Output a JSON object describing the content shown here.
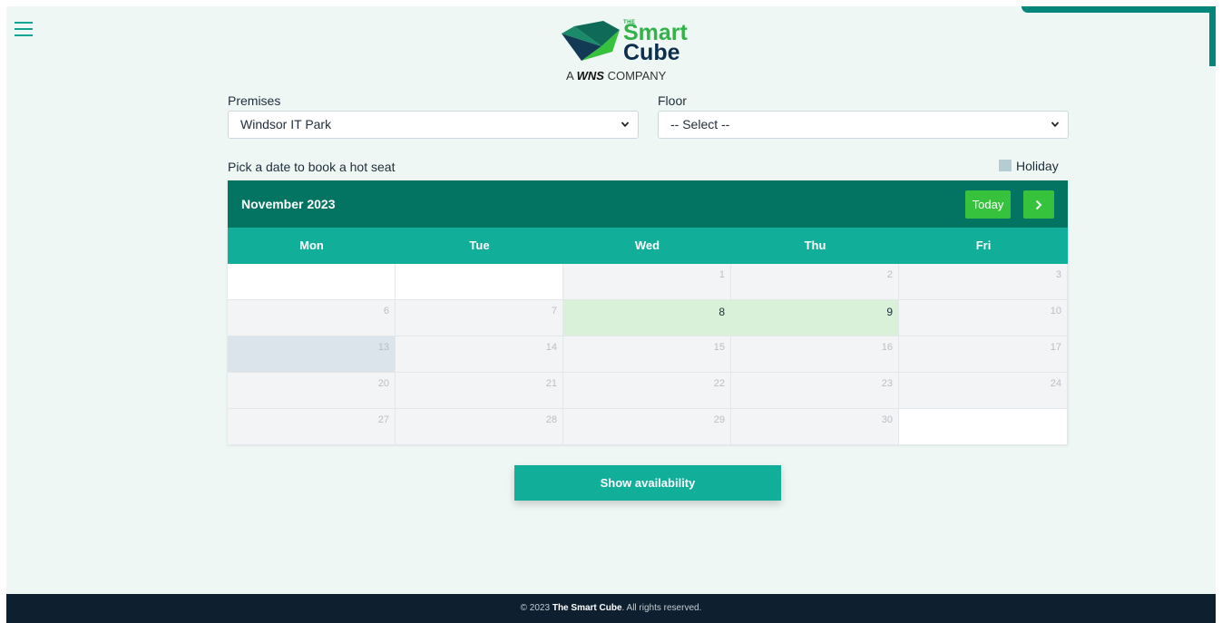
{
  "brand": {
    "the": "THE",
    "smart": "Smart",
    "cube": "Cube",
    "tagline_prefix": "A",
    "tagline_bold": "WNS",
    "tagline_suffix": "COMPANY"
  },
  "filters": {
    "premises_label": "Premises",
    "premises_value": "Windsor IT Park",
    "floor_label": "Floor",
    "floor_value": "-- Select --"
  },
  "instruction": "Pick a date to book a hot seat",
  "legend": {
    "label": "Holiday",
    "color": "#b5ccd2"
  },
  "calendar": {
    "title": "November 2023",
    "today_label": "Today",
    "weekdays": [
      "Mon",
      "Tue",
      "Wed",
      "Thu",
      "Fri"
    ],
    "weeks": [
      [
        {
          "num": "",
          "state": "blank"
        },
        {
          "num": "",
          "state": "blank"
        },
        {
          "num": "1",
          "state": "past"
        },
        {
          "num": "2",
          "state": "past"
        },
        {
          "num": "3",
          "state": "past"
        }
      ],
      [
        {
          "num": "6",
          "state": "past"
        },
        {
          "num": "7",
          "state": "past"
        },
        {
          "num": "8",
          "state": "available"
        },
        {
          "num": "9",
          "state": "available"
        },
        {
          "num": "10",
          "state": "past"
        }
      ],
      [
        {
          "num": "13",
          "state": "holiday"
        },
        {
          "num": "14",
          "state": "past"
        },
        {
          "num": "15",
          "state": "past"
        },
        {
          "num": "16",
          "state": "past"
        },
        {
          "num": "17",
          "state": "past"
        }
      ],
      [
        {
          "num": "20",
          "state": "past"
        },
        {
          "num": "21",
          "state": "past"
        },
        {
          "num": "22",
          "state": "past"
        },
        {
          "num": "23",
          "state": "past"
        },
        {
          "num": "24",
          "state": "past"
        }
      ],
      [
        {
          "num": "27",
          "state": "past"
        },
        {
          "num": "28",
          "state": "past"
        },
        {
          "num": "29",
          "state": "past"
        },
        {
          "num": "30",
          "state": "past"
        },
        {
          "num": "",
          "state": "blank"
        }
      ]
    ]
  },
  "action": {
    "show_availability": "Show availability"
  },
  "footer": {
    "prefix": "© 2023",
    "brand": "The Smart Cube",
    "suffix": ". All rights reserved."
  },
  "colors": {
    "header": "#037462",
    "weekday_bar": "#11ae9a",
    "accent_green": "#37c23e",
    "available": "#d8f1d8",
    "holiday_cell": "#dbe4ea",
    "footer": "#0e2030"
  }
}
